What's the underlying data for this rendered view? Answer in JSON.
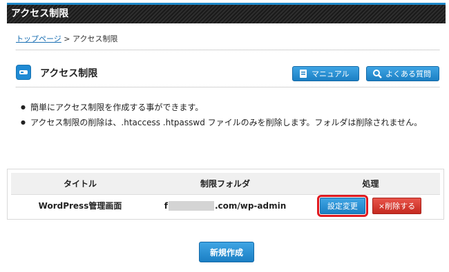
{
  "header": {
    "title": "アクセス制限"
  },
  "breadcrumb": {
    "home": "トップページ",
    "separator": " > ",
    "current": "アクセス制限"
  },
  "section": {
    "title": "アクセス制限",
    "icon": "key-icon",
    "manual_label": "マニュアル",
    "faq_label": "よくある質問"
  },
  "notes": [
    "簡単にアクセス制限を作成する事ができます。",
    "アクセス制限の削除は、.htaccess .htpasswd ファイルのみを削除します。フォルダは削除されません。"
  ],
  "table": {
    "headers": [
      "タイトル",
      "制限フォルダ",
      "処理"
    ],
    "rows": [
      {
        "title": "WordPress管理画面",
        "folder_prefix": "f",
        "folder_suffix": ".com/wp-admin",
        "edit_label": "設定変更",
        "delete_label": "×削除する"
      }
    ]
  },
  "create_label": "新規作成",
  "colors": {
    "accent": "#1d88c9",
    "danger": "#c52a20",
    "highlight": "#e0191f"
  }
}
